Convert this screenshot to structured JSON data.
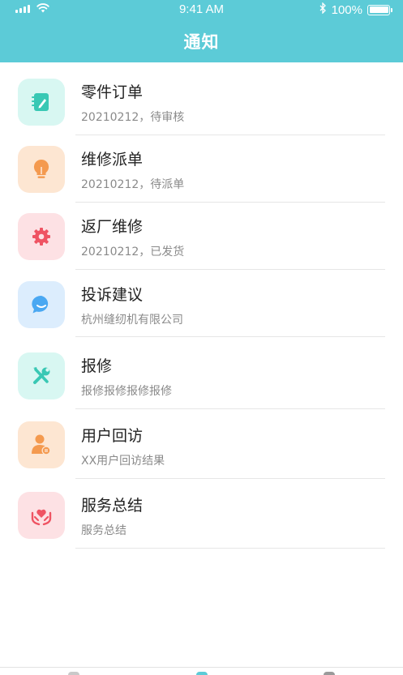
{
  "status_bar": {
    "time": "9:41 AM",
    "battery": "100%",
    "battery_level": 1.0
  },
  "header": {
    "title": "通知",
    "color": "#5ccbd7"
  },
  "items": [
    {
      "title": "零件订单",
      "subtitle": "20210212，待审核",
      "icon": "edit-note-icon",
      "icon_bg": "#d8f7f2",
      "icon_color": "#39c8b4"
    },
    {
      "title": "维修派单",
      "subtitle": "20210212，待派单",
      "icon": "lightbulb-icon",
      "icon_bg": "#fde6d2",
      "icon_color": "#f49a4f"
    },
    {
      "title": "返厂维修",
      "subtitle": "20210212，已发货",
      "icon": "gear-icon",
      "icon_bg": "#fde1e4",
      "icon_color": "#ef5463"
    },
    {
      "title": "投诉建议",
      "subtitle": "杭州缝纫机有限公司",
      "icon": "chat-bubble-icon",
      "icon_bg": "#dcedfd",
      "icon_color": "#4aa8f2"
    },
    {
      "title": "报修",
      "subtitle": "报修报修报修报修",
      "icon": "tools-icon",
      "icon_bg": "#d8f7f2",
      "icon_color": "#39c8b4"
    },
    {
      "title": "用户回访",
      "subtitle": "XX用户回访结果",
      "icon": "user-feedback-icon",
      "icon_bg": "#fde6d2",
      "icon_color": "#f49a4f"
    },
    {
      "title": "服务总结",
      "subtitle": "服务总结",
      "icon": "heart-hands-icon",
      "icon_bg": "#fde1e4",
      "icon_color": "#ef5463"
    }
  ]
}
